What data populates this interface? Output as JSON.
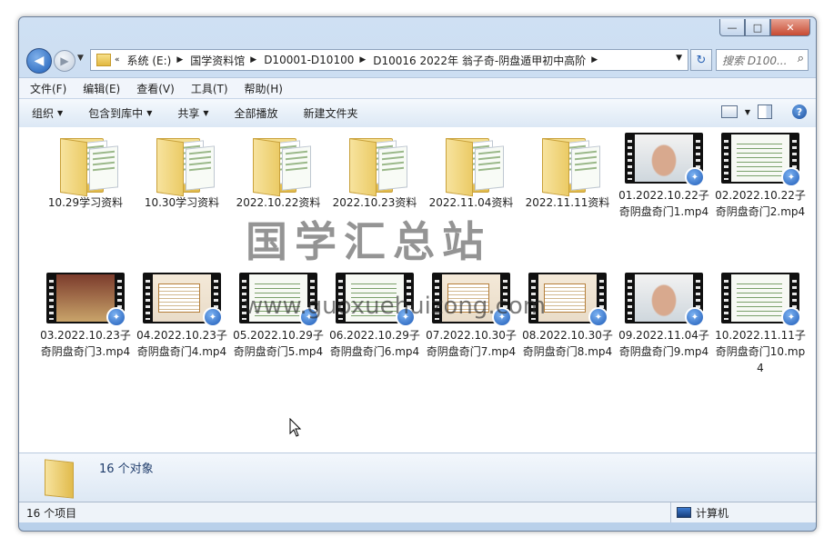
{
  "window": {
    "minimize_glyph": "—",
    "maximize_glyph": "□",
    "close_glyph": "✕"
  },
  "nav": {
    "back_glyph": "◀",
    "forward_glyph": "▶",
    "history_glyph": "▼",
    "overflow_glyph": "«",
    "breadcrumbs": [
      "系统 (E:)",
      "国学资料馆",
      "D10001-D10100",
      "D10016 2022年 翁子奇-阴盘遁甲初中高阶"
    ],
    "sep_glyph": "▶",
    "dropdown_glyph": "▼",
    "refresh_glyph": "↻",
    "search_placeholder": "搜索 D100...",
    "search_glyph": "⌕"
  },
  "menu": [
    "文件(F)",
    "编辑(E)",
    "查看(V)",
    "工具(T)",
    "帮助(H)"
  ],
  "toolbar": {
    "organize": "组织",
    "include_library": "包含到库中",
    "share": "共享",
    "play_all": "全部播放",
    "new_folder": "新建文件夹",
    "arrow_glyph": "▼",
    "help_glyph": "?"
  },
  "files": [
    {
      "kind": "folder",
      "name": "10.29学习资料"
    },
    {
      "kind": "folder",
      "name": "10.30学习资料"
    },
    {
      "kind": "folder",
      "name": "2022.10.22资料"
    },
    {
      "kind": "folder",
      "name": "2022.10.23资料"
    },
    {
      "kind": "folder",
      "name": "2022.11.04资料"
    },
    {
      "kind": "folder",
      "name": "2022.11.11资料"
    },
    {
      "kind": "video",
      "thumb": "face",
      "name": "01.2022.10.22子奇阴盘奇门1.mp4"
    },
    {
      "kind": "video",
      "thumb": "doc",
      "name": "02.2022.10.22子奇阴盘奇门2.mp4"
    },
    {
      "kind": "video",
      "thumb": "dark",
      "name": "03.2022.10.23子奇阴盘奇门3.mp4"
    },
    {
      "kind": "video",
      "thumb": "slide",
      "name": "04.2022.10.23子奇阴盘奇门4.mp4"
    },
    {
      "kind": "video",
      "thumb": "doc",
      "name": "05.2022.10.29子奇阴盘奇门5.mp4"
    },
    {
      "kind": "video",
      "thumb": "doc",
      "name": "06.2022.10.29子奇阴盘奇门6.mp4"
    },
    {
      "kind": "video",
      "thumb": "slide",
      "name": "07.2022.10.30子奇阴盘奇门7.mp4"
    },
    {
      "kind": "video",
      "thumb": "slide",
      "name": "08.2022.10.30子奇阴盘奇门8.mp4"
    },
    {
      "kind": "video",
      "thumb": "face",
      "name": "09.2022.11.04子奇阴盘奇门9.mp4"
    },
    {
      "kind": "video",
      "thumb": "doc",
      "name": "10.2022.11.11子奇阴盘奇门10.mp4"
    }
  ],
  "player_badge_glyph": "✦",
  "watermark": {
    "title": "国学汇总站",
    "url": "www.guoxuehuizong.com"
  },
  "details": {
    "count_text": "16 个对象"
  },
  "status": {
    "items_text": "16 个项目",
    "location_text": "计算机"
  }
}
